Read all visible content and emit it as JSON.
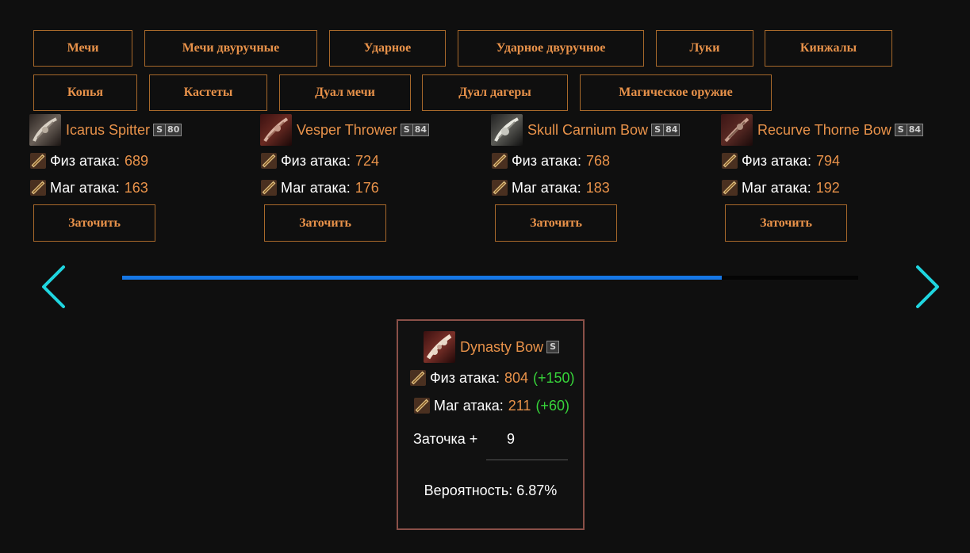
{
  "categories": [
    {
      "label": "Мечи"
    },
    {
      "label": "Мечи двуручные"
    },
    {
      "label": "Ударное"
    },
    {
      "label": "Ударное двуручное"
    },
    {
      "label": "Луки"
    },
    {
      "label": "Кинжалы"
    },
    {
      "label": "Копья"
    },
    {
      "label": "Кастеты"
    },
    {
      "label": "Дуал мечи"
    },
    {
      "label": "Дуал дагеры"
    },
    {
      "label": "Магическое оружие"
    }
  ],
  "stat_labels": {
    "phys": "Физ атака:",
    "mag": "Маг атака:"
  },
  "items": [
    {
      "name": "Icarus Spitter",
      "grade": "S",
      "grade_level": "80",
      "phys": "689",
      "mag": "163",
      "button": "Заточить",
      "icon": "bow-icon"
    },
    {
      "name": "Vesper Thrower",
      "grade": "S",
      "grade_level": "84",
      "phys": "724",
      "mag": "176",
      "button": "Заточить",
      "icon": "bow-icon"
    },
    {
      "name": "Skull Carnium Bow",
      "grade": "S",
      "grade_level": "84",
      "phys": "768",
      "mag": "183",
      "button": "Заточить",
      "icon": "bow-icon"
    },
    {
      "name": "Recurve Thorne Bow",
      "grade": "S",
      "grade_level": "84",
      "phys": "794",
      "mag": "192",
      "button": "Заточить",
      "icon": "bow-icon"
    }
  ],
  "carousel": {
    "progress": 0.815,
    "prev_icon": "chevron-left-icon",
    "next_icon": "chevron-right-icon",
    "color": "#1fd6e0",
    "bar_color": "#1677e6"
  },
  "selected": {
    "name": "Dynasty Bow",
    "grade": "S",
    "phys": "804",
    "phys_bonus": "(+150)",
    "mag": "211",
    "mag_bonus": "(+60)",
    "enchant_label": "Заточка +",
    "enchant_value": "9",
    "chance_label": "Вероятность: 6.87%"
  },
  "colors": {
    "accent": "#e8924a",
    "border": "#a8692b",
    "bonus": "#37d43a",
    "panel_border": "#8a5048",
    "background": "#0f0f0f"
  }
}
